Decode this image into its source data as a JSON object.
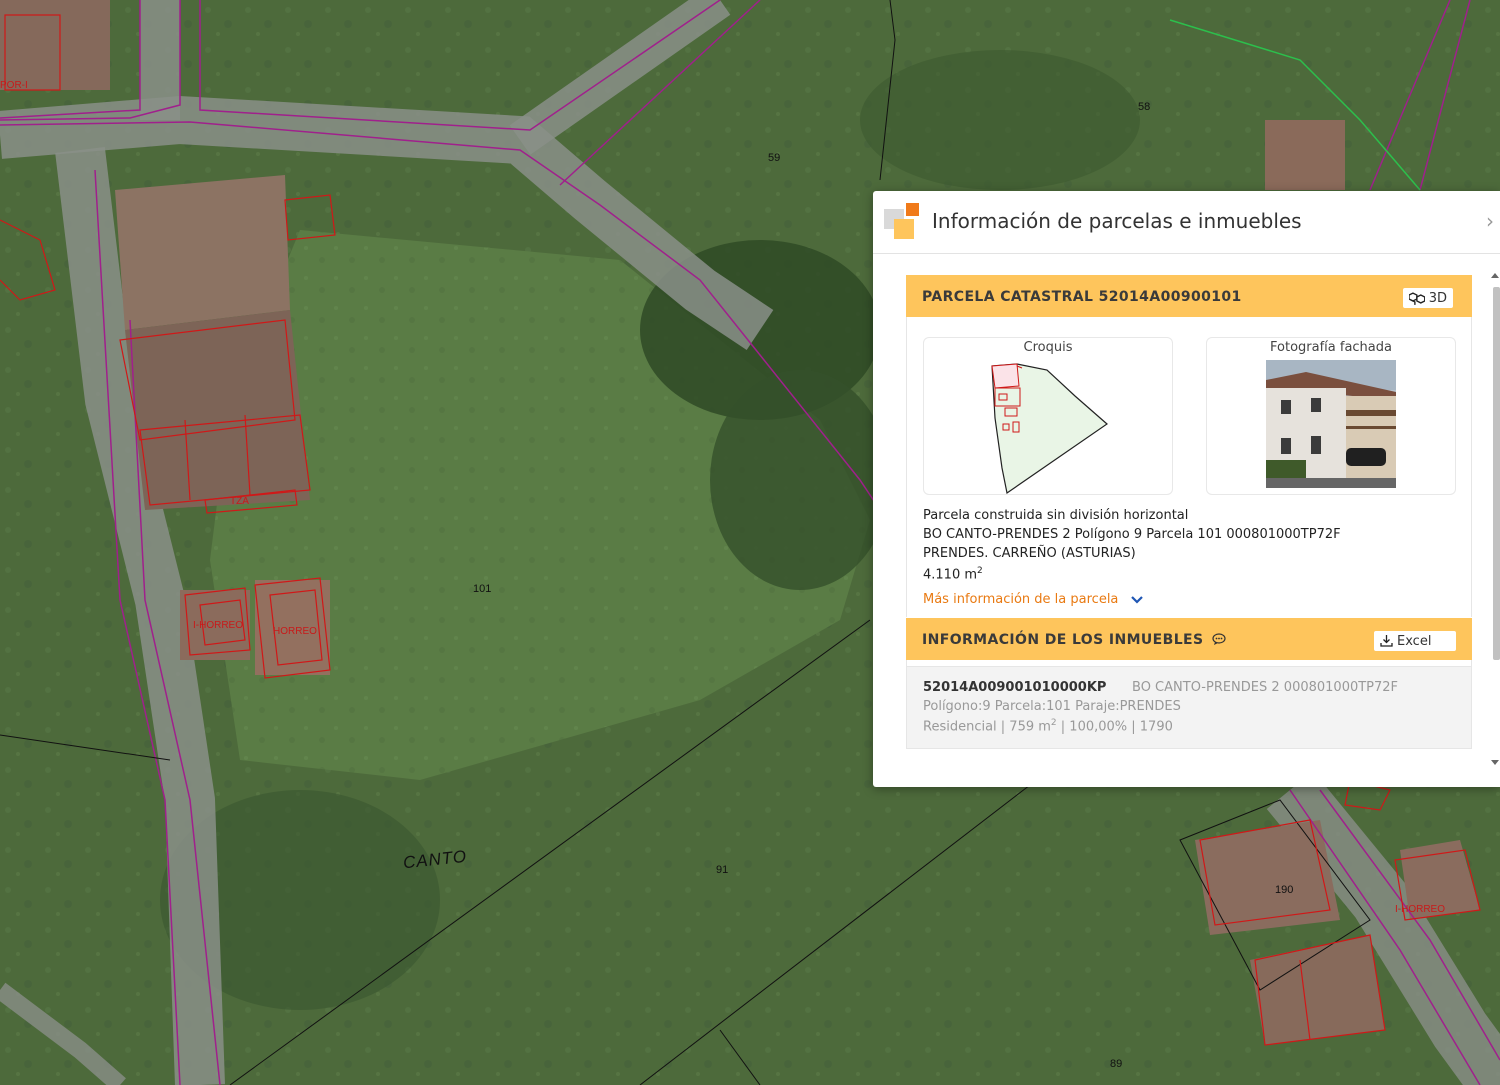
{
  "map": {
    "parcel_labels": [
      "59",
      "58",
      "101",
      "91",
      "190",
      "89"
    ],
    "street_label": "CANTO",
    "building_labels": [
      "I-HORREO",
      "HORREO",
      "I-HORREO",
      "TZA",
      "POR-I"
    ]
  },
  "panel": {
    "title": "Información de parcelas e inmuebles",
    "close_glyph": "›"
  },
  "parcela": {
    "heading": "PARCELA CATASTRAL 52014A00900101",
    "btn_3d": "3D",
    "croquis_label": "Croquis",
    "fachada_label": "Fotografía fachada",
    "type": "Parcela construida sin división horizontal",
    "address": "BO CANTO-PRENDES 2 Polígono 9 Parcela 101 000801000TP72F",
    "locality": "PRENDES. CARREÑO (ASTURIAS)",
    "area_value": "4.110 m",
    "area_sup": "2",
    "more_info": "Más información de la parcela"
  },
  "inmuebles": {
    "heading": "INFORMACIÓN DE LOS INMUEBLES",
    "excel_label": "Excel",
    "items": [
      {
        "ref": "52014A009001010000KP",
        "address": "BO CANTO-PRENDES 2 000801000TP72F",
        "location": "Polígono:9 Parcela:101 Paraje:PRENDES",
        "use_prefix": "Residencial | 759 m",
        "use_sup": "2",
        "use_suffix": " | 100,00% | 1790"
      }
    ]
  },
  "colors": {
    "accent": "#fec55c",
    "link": "#e97a12",
    "parcel_line": "#a0208c",
    "building_line": "#d01818"
  }
}
